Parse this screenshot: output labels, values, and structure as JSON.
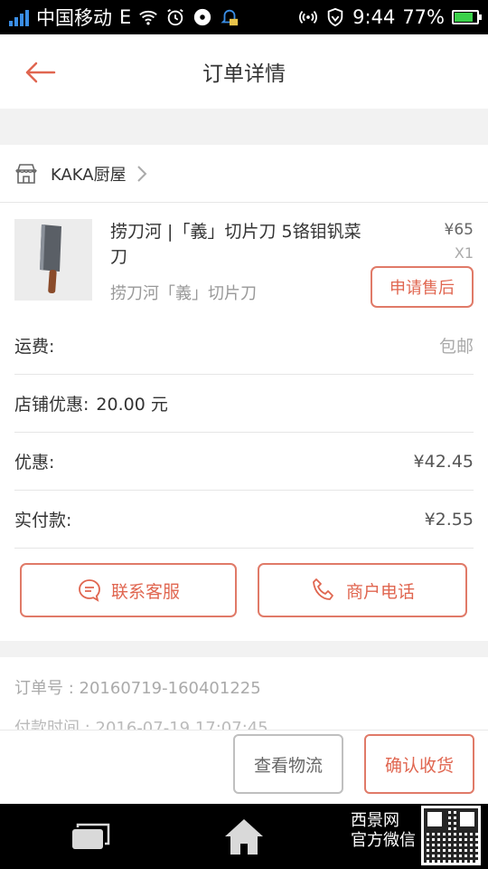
{
  "status_bar": {
    "carrier": "中国移动",
    "network": "E",
    "time": "9:44",
    "battery": "77%"
  },
  "header": {
    "title": "订单详情"
  },
  "shop": {
    "name": "KAKA厨屋"
  },
  "product": {
    "name": "捞刀河 |「義」切片刀 5铬钼钒菜刀",
    "spec": "捞刀河「義」切片刀",
    "price": "¥65",
    "quantity": "X1",
    "after_sale_label": "申请售后"
  },
  "summary": {
    "shipping_label": "运费:",
    "shipping_value": "包邮",
    "store_discount_label": "店铺优惠:",
    "store_discount_value": "20.00 元",
    "discount_label": "优惠:",
    "discount_value": "¥42.45",
    "paid_label": "实付款:",
    "paid_value": "¥2.55"
  },
  "actions": {
    "contact_service": "联系客服",
    "merchant_phone": "商户电话"
  },
  "order_info": {
    "order_no": "订单号 : 20160719-160401225",
    "pay_time_partial": "付款时间 : 2016-07-19 17:07:45"
  },
  "bottom_actions": {
    "view_logistics": "查看物流",
    "confirm_receipt": "确认收货"
  },
  "watermark": {
    "line1": "西景网",
    "line2": "官方微信"
  },
  "colors": {
    "accent": "#e06650",
    "border_accent": "#e07a68",
    "muted": "#aaaaaa"
  }
}
